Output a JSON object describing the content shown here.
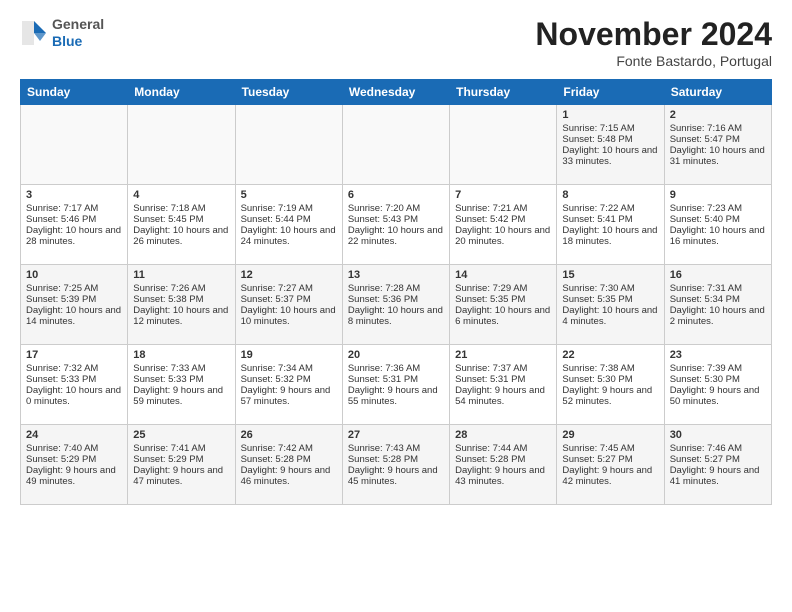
{
  "header": {
    "logo_general": "General",
    "logo_blue": "Blue",
    "month_title": "November 2024",
    "subtitle": "Fonte Bastardo, Portugal"
  },
  "weekdays": [
    "Sunday",
    "Monday",
    "Tuesday",
    "Wednesday",
    "Thursday",
    "Friday",
    "Saturday"
  ],
  "rows": [
    [
      {
        "day": "",
        "info": ""
      },
      {
        "day": "",
        "info": ""
      },
      {
        "day": "",
        "info": ""
      },
      {
        "day": "",
        "info": ""
      },
      {
        "day": "",
        "info": ""
      },
      {
        "day": "1",
        "info": "Sunrise: 7:15 AM\nSunset: 5:48 PM\nDaylight: 10 hours and 33 minutes."
      },
      {
        "day": "2",
        "info": "Sunrise: 7:16 AM\nSunset: 5:47 PM\nDaylight: 10 hours and 31 minutes."
      }
    ],
    [
      {
        "day": "3",
        "info": "Sunrise: 7:17 AM\nSunset: 5:46 PM\nDaylight: 10 hours and 28 minutes."
      },
      {
        "day": "4",
        "info": "Sunrise: 7:18 AM\nSunset: 5:45 PM\nDaylight: 10 hours and 26 minutes."
      },
      {
        "day": "5",
        "info": "Sunrise: 7:19 AM\nSunset: 5:44 PM\nDaylight: 10 hours and 24 minutes."
      },
      {
        "day": "6",
        "info": "Sunrise: 7:20 AM\nSunset: 5:43 PM\nDaylight: 10 hours and 22 minutes."
      },
      {
        "day": "7",
        "info": "Sunrise: 7:21 AM\nSunset: 5:42 PM\nDaylight: 10 hours and 20 minutes."
      },
      {
        "day": "8",
        "info": "Sunrise: 7:22 AM\nSunset: 5:41 PM\nDaylight: 10 hours and 18 minutes."
      },
      {
        "day": "9",
        "info": "Sunrise: 7:23 AM\nSunset: 5:40 PM\nDaylight: 10 hours and 16 minutes."
      }
    ],
    [
      {
        "day": "10",
        "info": "Sunrise: 7:25 AM\nSunset: 5:39 PM\nDaylight: 10 hours and 14 minutes."
      },
      {
        "day": "11",
        "info": "Sunrise: 7:26 AM\nSunset: 5:38 PM\nDaylight: 10 hours and 12 minutes."
      },
      {
        "day": "12",
        "info": "Sunrise: 7:27 AM\nSunset: 5:37 PM\nDaylight: 10 hours and 10 minutes."
      },
      {
        "day": "13",
        "info": "Sunrise: 7:28 AM\nSunset: 5:36 PM\nDaylight: 10 hours and 8 minutes."
      },
      {
        "day": "14",
        "info": "Sunrise: 7:29 AM\nSunset: 5:35 PM\nDaylight: 10 hours and 6 minutes."
      },
      {
        "day": "15",
        "info": "Sunrise: 7:30 AM\nSunset: 5:35 PM\nDaylight: 10 hours and 4 minutes."
      },
      {
        "day": "16",
        "info": "Sunrise: 7:31 AM\nSunset: 5:34 PM\nDaylight: 10 hours and 2 minutes."
      }
    ],
    [
      {
        "day": "17",
        "info": "Sunrise: 7:32 AM\nSunset: 5:33 PM\nDaylight: 10 hours and 0 minutes."
      },
      {
        "day": "18",
        "info": "Sunrise: 7:33 AM\nSunset: 5:33 PM\nDaylight: 9 hours and 59 minutes."
      },
      {
        "day": "19",
        "info": "Sunrise: 7:34 AM\nSunset: 5:32 PM\nDaylight: 9 hours and 57 minutes."
      },
      {
        "day": "20",
        "info": "Sunrise: 7:36 AM\nSunset: 5:31 PM\nDaylight: 9 hours and 55 minutes."
      },
      {
        "day": "21",
        "info": "Sunrise: 7:37 AM\nSunset: 5:31 PM\nDaylight: 9 hours and 54 minutes."
      },
      {
        "day": "22",
        "info": "Sunrise: 7:38 AM\nSunset: 5:30 PM\nDaylight: 9 hours and 52 minutes."
      },
      {
        "day": "23",
        "info": "Sunrise: 7:39 AM\nSunset: 5:30 PM\nDaylight: 9 hours and 50 minutes."
      }
    ],
    [
      {
        "day": "24",
        "info": "Sunrise: 7:40 AM\nSunset: 5:29 PM\nDaylight: 9 hours and 49 minutes."
      },
      {
        "day": "25",
        "info": "Sunrise: 7:41 AM\nSunset: 5:29 PM\nDaylight: 9 hours and 47 minutes."
      },
      {
        "day": "26",
        "info": "Sunrise: 7:42 AM\nSunset: 5:28 PM\nDaylight: 9 hours and 46 minutes."
      },
      {
        "day": "27",
        "info": "Sunrise: 7:43 AM\nSunset: 5:28 PM\nDaylight: 9 hours and 45 minutes."
      },
      {
        "day": "28",
        "info": "Sunrise: 7:44 AM\nSunset: 5:28 PM\nDaylight: 9 hours and 43 minutes."
      },
      {
        "day": "29",
        "info": "Sunrise: 7:45 AM\nSunset: 5:27 PM\nDaylight: 9 hours and 42 minutes."
      },
      {
        "day": "30",
        "info": "Sunrise: 7:46 AM\nSunset: 5:27 PM\nDaylight: 9 hours and 41 minutes."
      }
    ]
  ]
}
